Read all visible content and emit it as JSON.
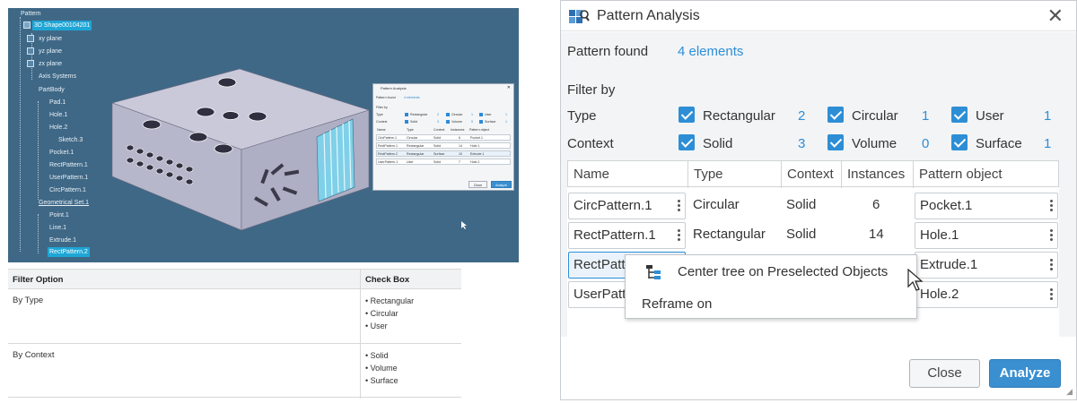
{
  "tree": {
    "items": [
      {
        "label": "Pattern"
      },
      {
        "label": "3D Shape00104201"
      },
      {
        "label": "xy plane"
      },
      {
        "label": "yz plane"
      },
      {
        "label": "zx plane"
      },
      {
        "label": "Axis Systems"
      },
      {
        "label": "PartBody"
      },
      {
        "label": "Pad.1"
      },
      {
        "label": "Hole.1"
      },
      {
        "label": "Hole.2"
      },
      {
        "label": "Sketch.3"
      },
      {
        "label": "Pocket.1"
      },
      {
        "label": "RectPattern.1"
      },
      {
        "label": "UserPattern.1"
      },
      {
        "label": "CircPattern.1"
      },
      {
        "label": "Geometrical Set.1"
      },
      {
        "label": "Point.1"
      },
      {
        "label": "Line.1"
      },
      {
        "label": "Extrude.1"
      },
      {
        "label": "RectPattern.2"
      }
    ]
  },
  "filter_table": {
    "headers": [
      "Filter Option",
      "Check Box"
    ],
    "rows": [
      {
        "option": "By Type",
        "items": [
          "• Rectangular",
          "• Circular",
          "• User"
        ]
      },
      {
        "option": "By Context",
        "items": [
          "• Solid",
          "• Volume",
          "• Surface"
        ]
      }
    ]
  },
  "dialog": {
    "title": "Pattern Analysis",
    "close_glyph": "✕",
    "pattern_found_label": "Pattern found",
    "pattern_found_value": "4 elements",
    "filter_by_label": "Filter by",
    "type_label": "Type",
    "context_label": "Context",
    "type_filters": [
      {
        "label": "Rectangular",
        "count": "2",
        "checked": true
      },
      {
        "label": "Circular",
        "count": "1",
        "checked": true
      },
      {
        "label": "User",
        "count": "1",
        "checked": true
      }
    ],
    "context_filters": [
      {
        "label": "Solid",
        "count": "3",
        "checked": true
      },
      {
        "label": "Volume",
        "count": "0",
        "checked": true
      },
      {
        "label": "Surface",
        "count": "1",
        "checked": true
      }
    ],
    "columns": [
      "Name",
      "Type",
      "Context",
      "Instances",
      "Pattern object"
    ],
    "rows": [
      {
        "name": "CircPattern.1",
        "type": "Circular",
        "context": "Solid",
        "instances": "6",
        "object": "Pocket.1"
      },
      {
        "name": "RectPattern.1",
        "type": "Rectangular",
        "context": "Solid",
        "instances": "14",
        "object": "Hole.1"
      },
      {
        "name": "RectPatt",
        "type": "",
        "context": "",
        "instances": "",
        "object": "Extrude.1"
      },
      {
        "name": "UserPatte",
        "type": "",
        "context": "",
        "instances": "",
        "object": "Hole.2"
      }
    ],
    "context_menu": [
      {
        "label": "Center tree on Preselected Objects"
      },
      {
        "label": "Reframe on"
      }
    ],
    "buttons": {
      "close": "Close",
      "analyze": "Analyze"
    }
  },
  "mini_dialog": {
    "title": "Pattern Analysis",
    "close_glyph": "✕",
    "pattern_found_label": "Pattern found",
    "pattern_found_value": "4 elements",
    "filter_by": "Filter by",
    "type_label": "Type",
    "context_label": "Context",
    "type_filters": [
      {
        "label": "Rectangular",
        "count": "2"
      },
      {
        "label": "Circular",
        "count": "1"
      },
      {
        "label": "User",
        "count": "1"
      }
    ],
    "context_filters": [
      {
        "label": "Solid",
        "count": "3"
      },
      {
        "label": "Volume",
        "count": "0"
      },
      {
        "label": "Surface",
        "count": "1"
      }
    ],
    "columns": [
      "Name",
      "Type",
      "Context",
      "Instances",
      "Pattern object"
    ],
    "rows": [
      {
        "name": "CircPattern.1",
        "type": "Circular",
        "context": "Solid",
        "instances": "6",
        "object": "Pocket.1"
      },
      {
        "name": "RectPattern.1",
        "type": "Rectangular",
        "context": "Solid",
        "instances": "14",
        "object": "Hole.1"
      },
      {
        "name": "RectPattern.2",
        "type": "Rectangular",
        "context": "Surface",
        "instances": "10",
        "object": "Extrude.1"
      },
      {
        "name": "UserPattern.1",
        "type": "User",
        "context": "Solid",
        "instances": "7",
        "object": "Hole.2"
      }
    ],
    "buttons": {
      "close": "Close",
      "analyze": "Analyze"
    }
  },
  "colors": {
    "viewport_bg": "#3f6886",
    "accent_blue": "#2d8ed6",
    "tree_selected": "#1ea6d6",
    "part_body": "#c8c8d8",
    "highlight_surface": "#7fd0e8"
  }
}
